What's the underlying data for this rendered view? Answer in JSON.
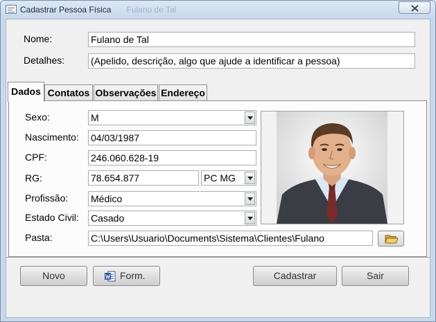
{
  "window": {
    "title": "Cadastrar Pessoa Física",
    "ghost_title": "Fulano de Tal"
  },
  "form": {
    "nome_label": "Nome:",
    "nome_value": "Fulano de Tal",
    "detalhes_label": "Detalhes:",
    "detalhes_value": "(Apelido, descrição, algo que ajude a identificar a pessoa)"
  },
  "tabs": [
    {
      "label": "Dados",
      "active": true
    },
    {
      "label": "Contatos"
    },
    {
      "label": "Observações"
    },
    {
      "label": "Endereço"
    }
  ],
  "dados": {
    "sexo_label": "Sexo:",
    "sexo_value": "M",
    "nascimento_label": "Nascimento:",
    "nascimento_value": "04/03/1987",
    "cpf_label": "CPF:",
    "cpf_value": "246.060.628-19",
    "rg_label": "RG:",
    "rg_value": "78.654.877",
    "rg_orgao_value": "PC MG",
    "profissao_label": "Profissão:",
    "profissao_value": "Médico",
    "estado_civil_label": "Estado Civil:",
    "estado_civil_value": "Casado",
    "pasta_label": "Pasta:",
    "pasta_value": "C:\\Users\\Usuario\\Documents\\Sistema\\Clientes\\Fulano"
  },
  "buttons": {
    "novo": "Novo",
    "form": "Form.",
    "cadastrar": "Cadastrar",
    "sair": "Sair"
  },
  "icons": {
    "app": "form-icon",
    "close": "close-icon",
    "folder": "folder-open-icon",
    "word": "word-document-icon"
  },
  "colors": {
    "title_bar": "#c7d8ec",
    "folder": "#e8b84a",
    "word_blue": "#2b5797"
  }
}
